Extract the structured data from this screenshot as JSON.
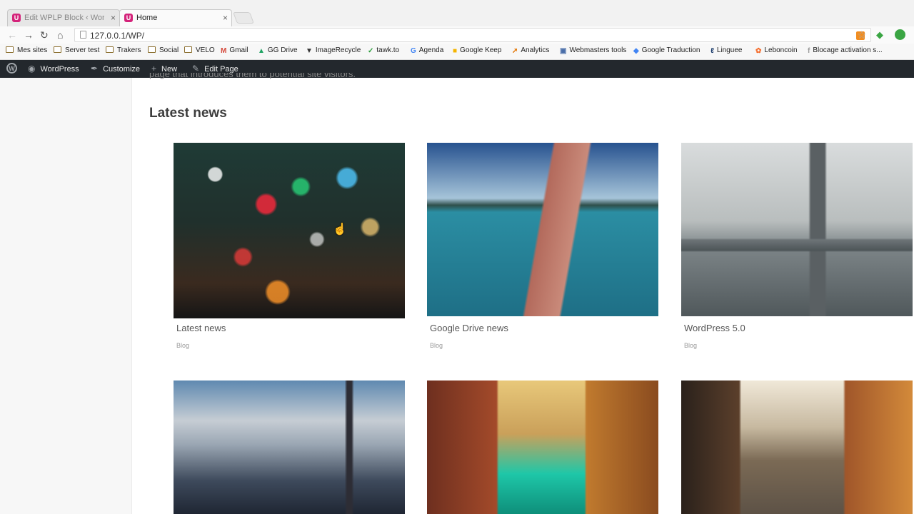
{
  "browser": {
    "tabs": [
      {
        "label": "Edit WPLP Block ‹ WordPr",
        "active": false
      },
      {
        "label": "Home",
        "active": true
      }
    ],
    "tab_close_glyph": "×",
    "url": "127.0.0.1/WP/",
    "bookmarks": [
      {
        "label": "Mes sites",
        "icon": "folder-icon"
      },
      {
        "label": "Server test",
        "icon": "folder-icon"
      },
      {
        "label": "Trakers",
        "icon": "folder-icon"
      },
      {
        "label": "Social",
        "icon": "folder-icon"
      },
      {
        "label": "VELO",
        "icon": "folder-icon"
      },
      {
        "label": "Gmail",
        "icon": "gmail-icon"
      },
      {
        "label": "GG Drive",
        "icon": "drive-icon"
      },
      {
        "label": "ImageRecycle",
        "icon": "imagerecycle-icon"
      },
      {
        "label": "tawk.to",
        "icon": "tawk-icon"
      },
      {
        "label": "Agenda",
        "icon": "google-icon"
      },
      {
        "label": "Google Keep",
        "icon": "keep-icon"
      },
      {
        "label": "Analytics",
        "icon": "analytics-icon"
      },
      {
        "label": "Webmasters tools",
        "icon": "webmasters-icon"
      },
      {
        "label": "Google Traduction",
        "icon": "translate-icon"
      },
      {
        "label": "Linguee",
        "icon": "linguee-icon"
      },
      {
        "label": "Leboncoin",
        "icon": "leboncoin-icon"
      },
      {
        "label": "Blocage activation s...",
        "icon": "page-icon"
      }
    ]
  },
  "adminbar": {
    "site": "WordPress",
    "customize": "Customize",
    "new": "New",
    "edit_page": "Edit Page"
  },
  "page": {
    "clipped_text": "page that introduces them to potential site visitors.",
    "section_title": "Latest news",
    "posts": [
      {
        "title": "Latest news",
        "category": "Blog"
      },
      {
        "title": "Google Drive news",
        "category": "Blog"
      },
      {
        "title": "WordPress 5.0",
        "category": "Blog"
      }
    ]
  },
  "colors": {
    "adminbar_bg": "#23282d",
    "favicon": "#d4237a"
  }
}
